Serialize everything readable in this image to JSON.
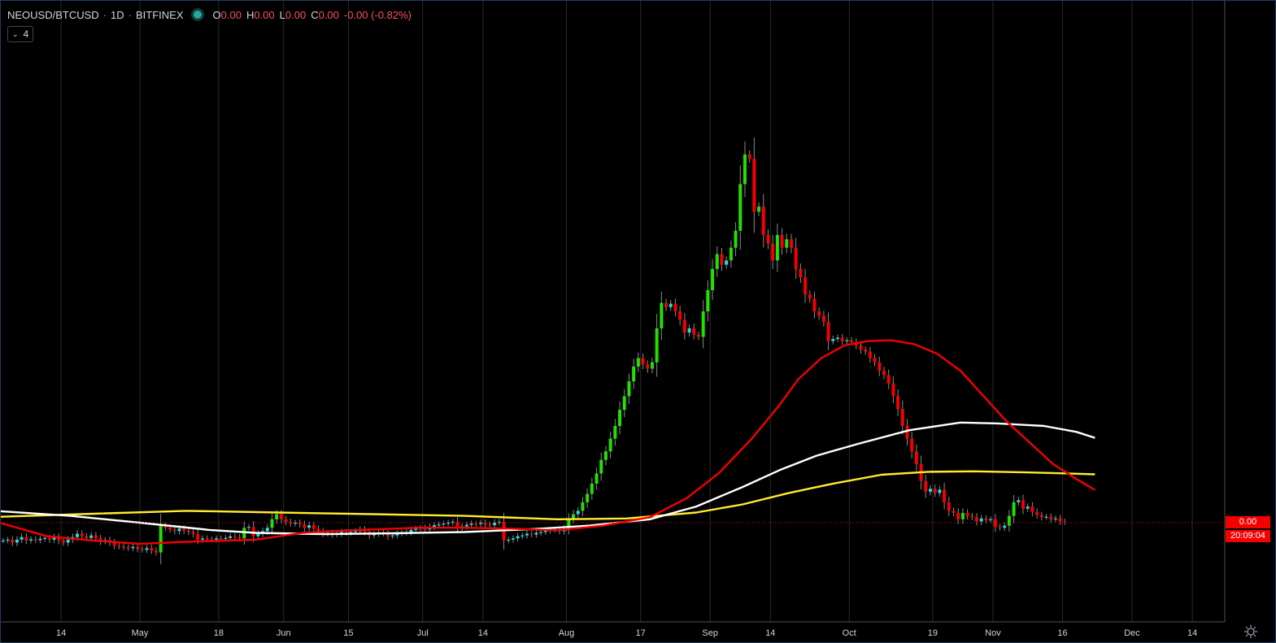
{
  "header": {
    "symbol": "NEOUSD/BTCUSD",
    "interval": "1D",
    "exchange": "BITFINEX",
    "open": "0.00",
    "high": "0.00",
    "low": "0.00",
    "close": "0.00",
    "change": "-0.00 (-0.82%)"
  },
  "indicators_toggle": {
    "icon": "chevron-down-icon",
    "count": "4"
  },
  "price_axis": {
    "last_price": "0.00",
    "countdown": "20:09:04"
  },
  "colors": {
    "up": "#22e000",
    "down": "#f40000",
    "up_small": "#28d8e8",
    "ma_fast": "#f40000",
    "ma_mid": "#ffffff",
    "ma_slow": "#ffec2e",
    "grid": "#2a2a2a"
  },
  "settings_icon": "gear-icon",
  "chart_data": {
    "type": "candlestick",
    "grid": true,
    "x_start": "2020-04-01",
    "x_end": "2020-12-21",
    "x_ticks": [
      "14",
      "May",
      "18",
      "Jun",
      "15",
      "Jul",
      "14",
      "Aug",
      "17",
      "Sep",
      "14",
      "Oct",
      "19",
      "Nov",
      "16",
      "Dec",
      "14"
    ],
    "x_tick_dates": [
      "2020-04-14",
      "2020-05-01",
      "2020-05-18",
      "2020-06-01",
      "2020-06-15",
      "2020-07-01",
      "2020-07-14",
      "2020-08-01",
      "2020-08-17",
      "2020-09-01",
      "2020-09-14",
      "2020-10-01",
      "2020-10-19",
      "2020-11-01",
      "2020-11-16",
      "2020-12-01",
      "2020-12-14"
    ],
    "candles_close": [
      0.61,
      0.612,
      0.605,
      0.612,
      0.618,
      0.61,
      0.613,
      0.611,
      0.614,
      0.616,
      0.612,
      0.618,
      0.61,
      0.605,
      0.612,
      0.618,
      0.626,
      0.62,
      0.616,
      0.622,
      0.615,
      0.608,
      0.611,
      0.605,
      0.598,
      0.596,
      0.594,
      0.592,
      0.595,
      0.59,
      0.588,
      0.592,
      0.586,
      0.582,
      0.645,
      0.64,
      0.636,
      0.632,
      0.638,
      0.633,
      0.63,
      0.625,
      0.612,
      0.615,
      0.613,
      0.612,
      0.615,
      0.614,
      0.616,
      0.62,
      0.618,
      0.615,
      0.64,
      0.642,
      0.62,
      0.626,
      0.632,
      0.64,
      0.66,
      0.672,
      0.66,
      0.654,
      0.65,
      0.652,
      0.648,
      0.64,
      0.646,
      0.638,
      0.632,
      0.626,
      0.628,
      0.624,
      0.626,
      0.63,
      0.628,
      0.63,
      0.632,
      0.636,
      0.63,
      0.622,
      0.625,
      0.628,
      0.626,
      0.62,
      0.622,
      0.626,
      0.628,
      0.63,
      0.635,
      0.638,
      0.64,
      0.636,
      0.642,
      0.646,
      0.648,
      0.65,
      0.652,
      0.654,
      0.64,
      0.643,
      0.647,
      0.65,
      0.649,
      0.652,
      0.648,
      0.646,
      0.652,
      0.654,
      0.61,
      0.612,
      0.615,
      0.62,
      0.622,
      0.626,
      0.624,
      0.628,
      0.63,
      0.633,
      0.635,
      0.636,
      0.632,
      0.638,
      0.66,
      0.672,
      0.68,
      0.7,
      0.72,
      0.744,
      0.768,
      0.8,
      0.82,
      0.85,
      0.88,
      0.918,
      0.95,
      0.985,
      1.02,
      1.04,
      1.025,
      1.015,
      1.03,
      1.11,
      1.17,
      1.16,
      1.168,
      1.15,
      1.13,
      1.1,
      1.11,
      1.095,
      1.09,
      1.15,
      1.2,
      1.25,
      1.285,
      1.26,
      1.27,
      1.3,
      1.34,
      1.45,
      1.52,
      1.51,
      1.385,
      1.397,
      1.33,
      1.31,
      1.27,
      1.33,
      1.3,
      1.32,
      1.3,
      1.25,
      1.23,
      1.19,
      1.18,
      1.15,
      1.14,
      1.125,
      1.08,
      1.085,
      1.088,
      1.08,
      1.082,
      1.078,
      1.07,
      1.06,
      1.055,
      1.04,
      1.03,
      1.01,
      1.0,
      0.98,
      0.95,
      0.92,
      0.88,
      0.85,
      0.82,
      0.79,
      0.75,
      0.725,
      0.732,
      0.722,
      0.73,
      0.7,
      0.68,
      0.675,
      0.66,
      0.675,
      0.668,
      0.665,
      0.655,
      0.662,
      0.658,
      0.66,
      0.642,
      0.64,
      0.645,
      0.668,
      0.7,
      0.705,
      0.685,
      0.69,
      0.677,
      0.67,
      0.665,
      0.666,
      0.66,
      0.662,
      0.655,
      0.653
    ],
    "ma_fast": [
      [
        0,
        0.651
      ],
      [
        10,
        0.62
      ],
      [
        20,
        0.61
      ],
      [
        30,
        0.602
      ],
      [
        40,
        0.607
      ],
      [
        55,
        0.612
      ],
      [
        65,
        0.628
      ],
      [
        75,
        0.634
      ],
      [
        90,
        0.64
      ],
      [
        100,
        0.64
      ],
      [
        110,
        0.638
      ],
      [
        120,
        0.634
      ],
      [
        130,
        0.645
      ],
      [
        140,
        0.665
      ],
      [
        148,
        0.71
      ],
      [
        155,
        0.77
      ],
      [
        162,
        0.85
      ],
      [
        168,
        0.93
      ],
      [
        172,
        0.99
      ],
      [
        177,
        1.04
      ],
      [
        182,
        1.07
      ],
      [
        187,
        1.08
      ],
      [
        192,
        1.082
      ],
      [
        197,
        1.073
      ],
      [
        202,
        1.05
      ],
      [
        207,
        1.01
      ],
      [
        212,
        0.95
      ],
      [
        217,
        0.89
      ],
      [
        222,
        0.84
      ],
      [
        227,
        0.79
      ],
      [
        232,
        0.755
      ],
      [
        236,
        0.729
      ]
    ],
    "ma_mid": [
      [
        0,
        0.679
      ],
      [
        15,
        0.668
      ],
      [
        30,
        0.652
      ],
      [
        45,
        0.635
      ],
      [
        55,
        0.628
      ],
      [
        70,
        0.625
      ],
      [
        85,
        0.627
      ],
      [
        100,
        0.63
      ],
      [
        115,
        0.637
      ],
      [
        127,
        0.645
      ],
      [
        140,
        0.66
      ],
      [
        150,
        0.69
      ],
      [
        160,
        0.736
      ],
      [
        168,
        0.776
      ],
      [
        176,
        0.81
      ],
      [
        185,
        0.838
      ],
      [
        196,
        0.87
      ],
      [
        207,
        0.888
      ],
      [
        215,
        0.886
      ],
      [
        225,
        0.88
      ],
      [
        232,
        0.866
      ],
      [
        236,
        0.852
      ]
    ],
    "ma_slow": [
      [
        0,
        0.666
      ],
      [
        20,
        0.673
      ],
      [
        40,
        0.68
      ],
      [
        60,
        0.676
      ],
      [
        80,
        0.672
      ],
      [
        100,
        0.668
      ],
      [
        120,
        0.66
      ],
      [
        135,
        0.662
      ],
      [
        150,
        0.676
      ],
      [
        160,
        0.695
      ],
      [
        170,
        0.722
      ],
      [
        180,
        0.745
      ],
      [
        190,
        0.765
      ],
      [
        200,
        0.772
      ],
      [
        210,
        0.773
      ],
      [
        220,
        0.771
      ],
      [
        230,
        0.768
      ],
      [
        236,
        0.766
      ]
    ],
    "y_range": [
      0.56,
      1.7
    ],
    "last_price_value": 0.652
  }
}
